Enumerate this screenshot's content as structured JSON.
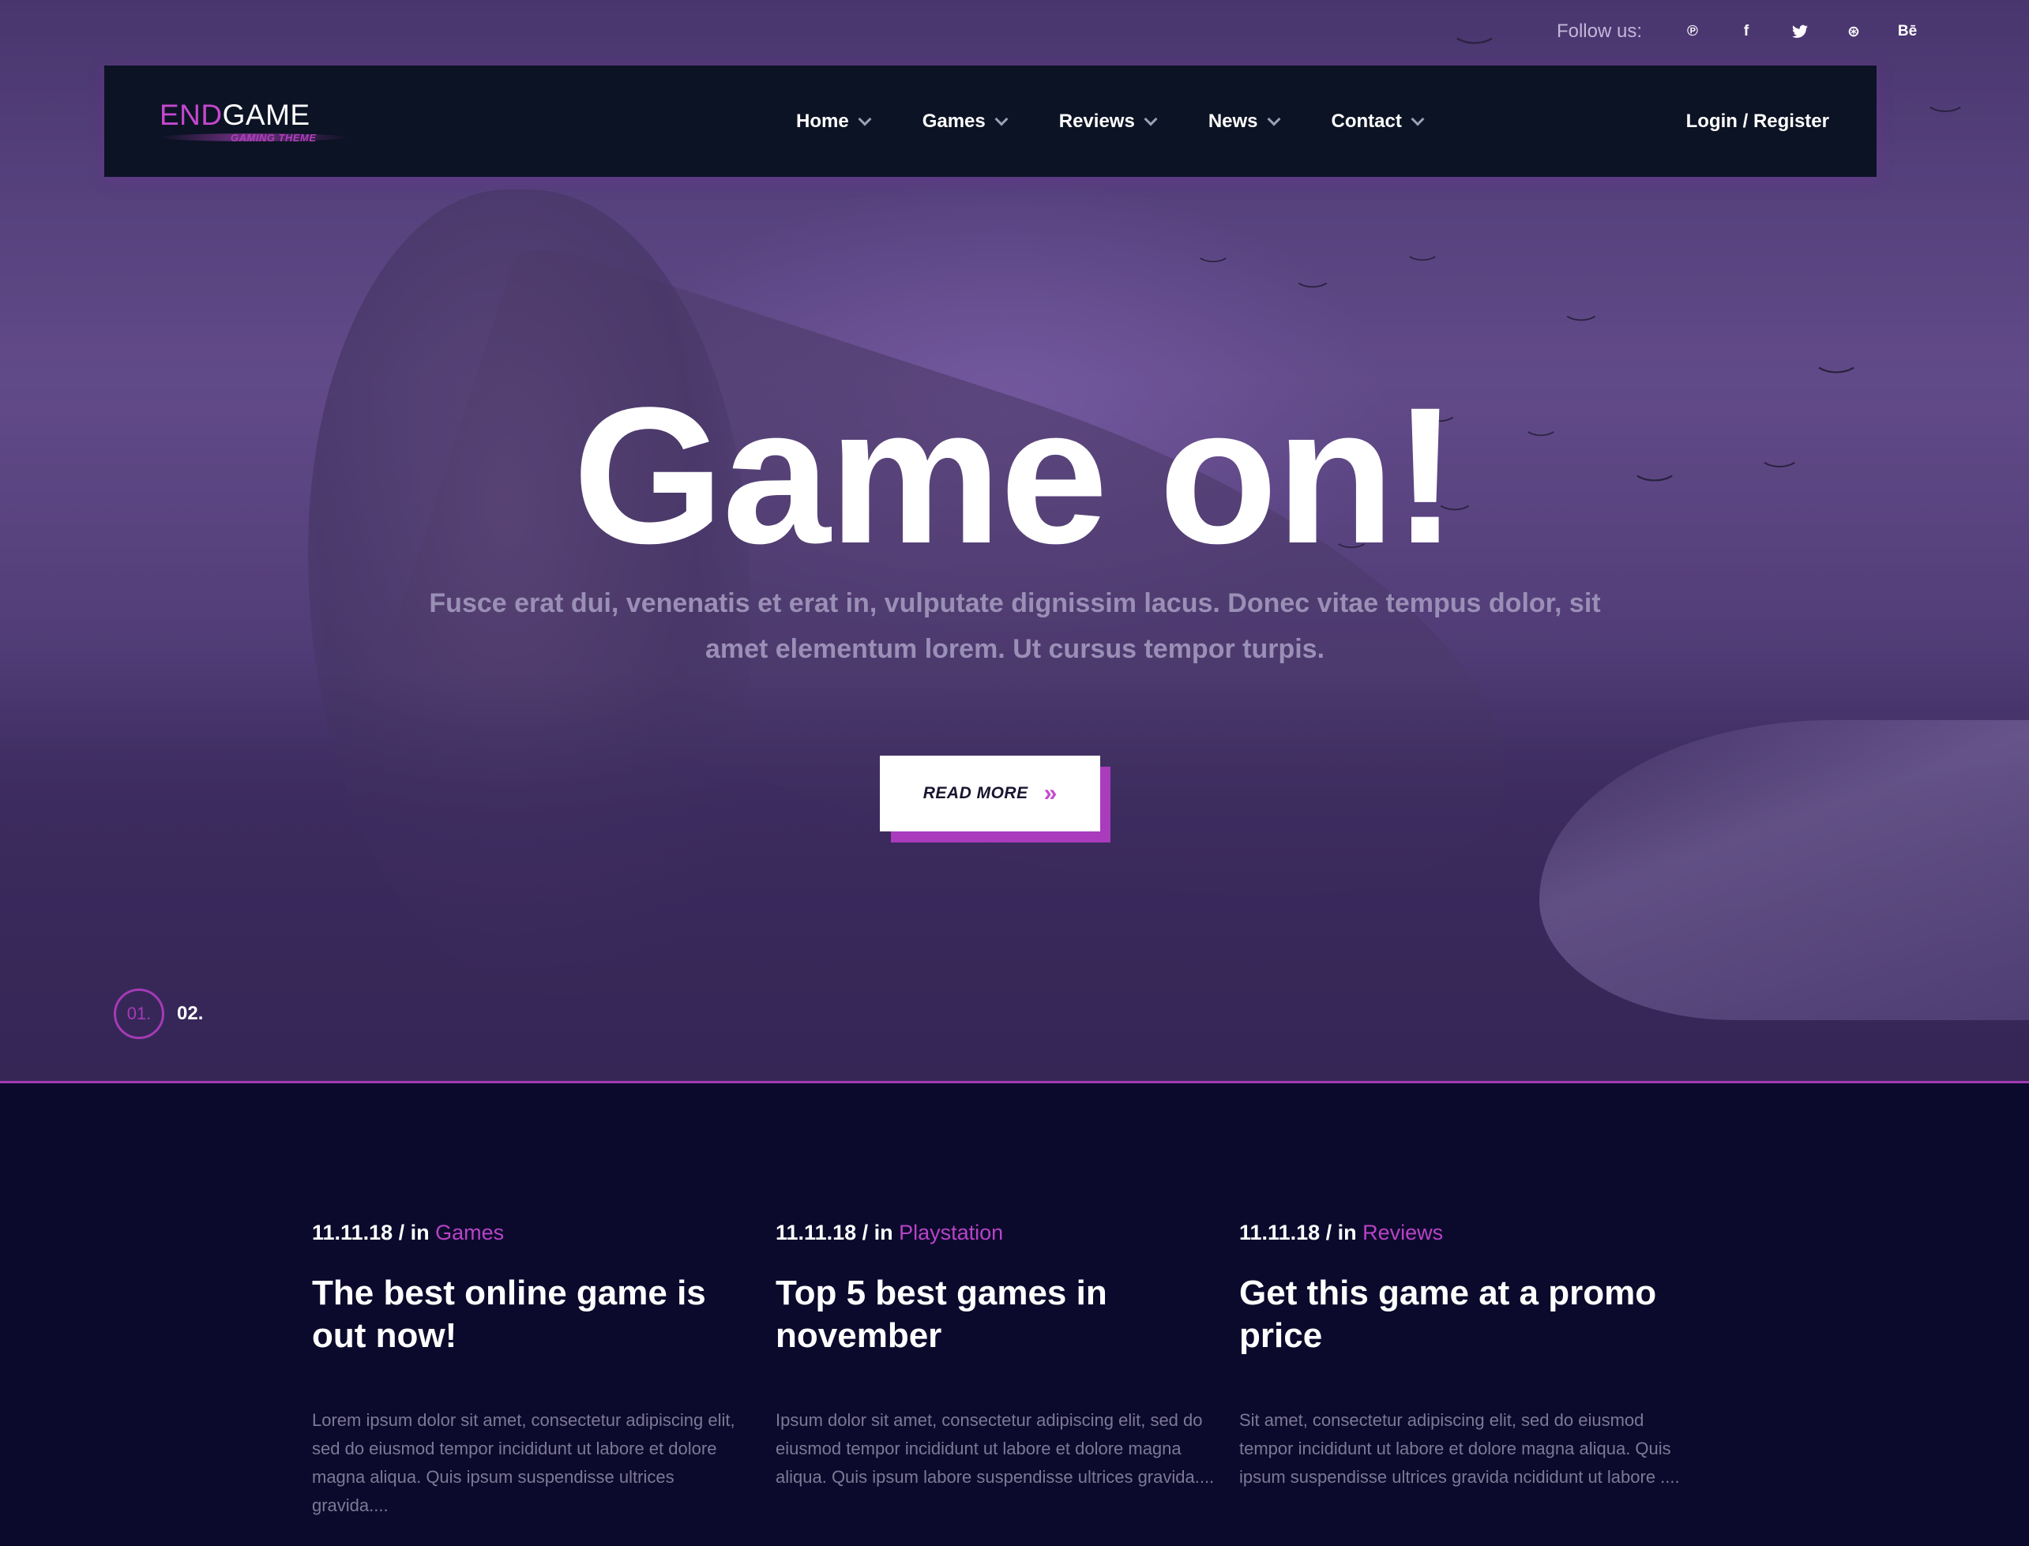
{
  "follow": {
    "label": "Follow us:",
    "socials": [
      {
        "icon": "pinterest-icon",
        "glyph": "℗"
      },
      {
        "icon": "facebook-icon",
        "glyph": "f"
      },
      {
        "icon": "twitter-icon",
        "glyph": "🐦"
      },
      {
        "icon": "dribbble-icon",
        "glyph": "⊛"
      },
      {
        "icon": "behance-icon",
        "glyph": "Bē"
      }
    ]
  },
  "logo": {
    "part1": "END",
    "part2": "GAME",
    "tagline": "GAMING THEME"
  },
  "nav": {
    "items": [
      "Home",
      "Games",
      "Reviews",
      "News",
      "Contact"
    ],
    "login": "Login / Register"
  },
  "hero": {
    "title": "Game on!",
    "subtitle": "Fusce erat dui, venenatis et erat in, vulputate dignissim lacus. Donec vitae tempus dolor, sit amet elementum lorem. Ut cursus tempor turpis.",
    "button": "READ MORE",
    "slides": [
      "01.",
      "02."
    ]
  },
  "posts": [
    {
      "date": "11.11.18 / in ",
      "category": "Games",
      "title": "The best online game is out now!",
      "excerpt": "Lorem ipsum dolor sit amet, consectetur adipiscing elit, sed do eiusmod tempor incididunt ut labore et dolore magna aliqua. Quis ipsum suspendisse ultrices gravida...."
    },
    {
      "date": "11.11.18 / in ",
      "category": "Playstation",
      "title": "Top 5 best games in november",
      "excerpt": "Ipsum dolor sit amet, consectetur adipiscing elit, sed do eiusmod tempor incididunt ut labore et dolore magna aliqua. Quis ipsum labore suspendisse ultrices gravida...."
    },
    {
      "date": "11.11.18 / in ",
      "category": "Reviews",
      "title": "Get this game at a promo price",
      "excerpt": "Sit amet, consectetur adipiscing elit, sed do eiusmod tempor incididunt ut labore et dolore magna aliqua. Quis ipsum suspendisse ultrices gravida ncididunt ut labore ...."
    }
  ],
  "colors": {
    "accent": "#b843c6",
    "navbar": "#0c1324",
    "section_bg": "#0b0a2c"
  }
}
